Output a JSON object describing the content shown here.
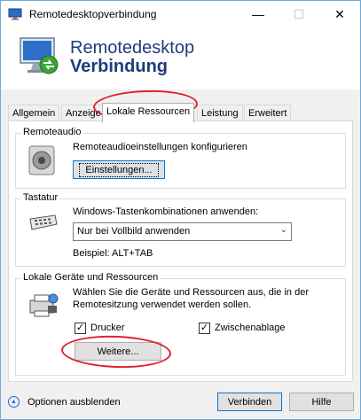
{
  "window": {
    "title": "Remotedesktopverbindung",
    "min_glyph": "—",
    "max_glyph": "☐",
    "close_glyph": "✕"
  },
  "banner": {
    "line1": "Remotedesktop",
    "line2": "Verbindung"
  },
  "tabs": [
    {
      "label": "Allgemein",
      "active": false
    },
    {
      "label": "Anzeige",
      "active": false
    },
    {
      "label": "Lokale Ressourcen",
      "active": true
    },
    {
      "label": "Leistung",
      "active": false
    },
    {
      "label": "Erweitert",
      "active": false
    }
  ],
  "remote_audio": {
    "legend": "Remoteaudio",
    "description": "Remoteaudioeinstellungen konfigurieren",
    "button": "Einstellungen...",
    "icon": "speaker-icon"
  },
  "keyboard": {
    "legend": "Tastatur",
    "description": "Windows-Tastenkombinationen anwenden:",
    "select_value": "Nur bei Vollbild anwenden",
    "example": "Beispiel: ALT+TAB",
    "icon": "keyboard-icon"
  },
  "local_devices": {
    "legend": "Lokale Geräte und Ressourcen",
    "description_line1": "Wählen Sie die Geräte und Ressourcen aus, die in der",
    "description_line2": "Remotesitzung verwendet werden sollen.",
    "printer_label": "Drucker",
    "printer_checked": true,
    "clipboard_label": "Zwischenablage",
    "clipboard_checked": true,
    "more_button": "Weitere...",
    "icon": "devices-icon"
  },
  "footer": {
    "options_label": "Optionen ausblenden",
    "connect_button": "Verbinden",
    "help_button": "Hilfe"
  },
  "colors": {
    "banner_text": "#1f3c7a",
    "annotation": "#e0202a",
    "focus_border": "#0078d7"
  }
}
